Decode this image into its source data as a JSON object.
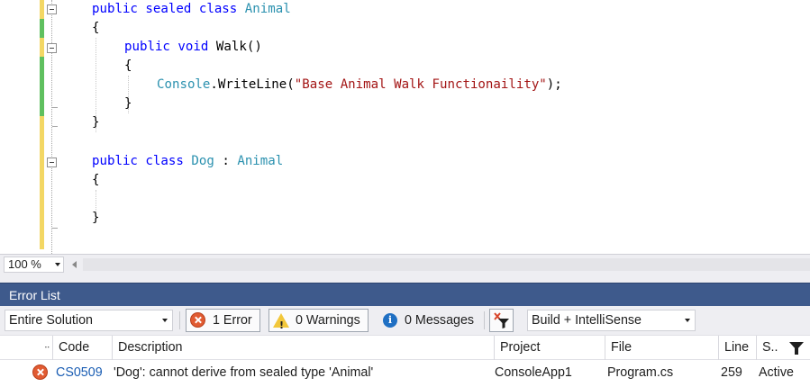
{
  "editor": {
    "lines": {
      "l1": {
        "kw1": "public",
        "kw2": "sealed",
        "kw3": "class",
        "type": "Animal"
      },
      "l2": {
        "brace": "{"
      },
      "l3": {
        "kw1": "public",
        "kw2": "void",
        "method": "Walk",
        "parens": "()"
      },
      "l4": {
        "brace": "{"
      },
      "l5": {
        "type": "Console",
        "dot": ".",
        "method": "WriteLine",
        "open": "(",
        "str": "\"Base Animal Walk Functionaility\"",
        "close": ");"
      },
      "l6": {
        "brace": "}"
      },
      "l7": {
        "brace": "}"
      },
      "l8": {
        "kw1": "public",
        "kw2": "class",
        "type": "Dog",
        "colon": ":",
        "base": "Animal"
      },
      "l9": {
        "brace": "{"
      },
      "l10": {
        "brace": "}"
      }
    },
    "colors": {
      "keyword": "#0000ff",
      "type": "#2b91af",
      "string": "#a31515",
      "change_saved": "#5fc05f",
      "change_unsaved": "#f3d764"
    }
  },
  "zoom": {
    "value": "100 %"
  },
  "error_list": {
    "title": "Error List",
    "scope_select": "Entire Solution",
    "errors_button": "1 Error",
    "warnings_button": "0 Warnings",
    "messages_button": "0 Messages",
    "source_select": "Build + IntelliSense",
    "columns": {
      "code": "Code",
      "description": "Description",
      "project": "Project",
      "file": "File",
      "line": "Line",
      "suppression": "S.."
    },
    "rows": [
      {
        "severity_icon": "error-icon",
        "code": "CS0509",
        "description": "'Dog': cannot derive from sealed type 'Animal'",
        "project": "ConsoleApp1",
        "file": "Program.cs",
        "line": "259",
        "suppression": "Active"
      }
    ],
    "title_bar_color": "#3e5a8c"
  }
}
